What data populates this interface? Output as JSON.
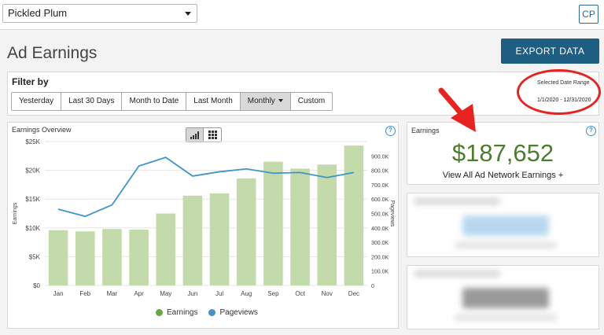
{
  "header": {
    "site_name": "Pickled Plum",
    "avatar_initials": "CP"
  },
  "page": {
    "title": "Ad Earnings",
    "export_label": "EXPORT DATA"
  },
  "filter": {
    "label": "Filter by",
    "buttons": [
      {
        "label": "Yesterday",
        "active": false
      },
      {
        "label": "Last 30 Days",
        "active": false
      },
      {
        "label": "Month to Date",
        "active": false
      },
      {
        "label": "Last Month",
        "active": false
      },
      {
        "label": "Monthly",
        "active": true
      },
      {
        "label": "Custom",
        "active": false
      }
    ],
    "date_range_label": "Selected Date Range",
    "date_range_value": "1/1/2020 - 12/31/2020"
  },
  "overview": {
    "title": "Earnings Overview",
    "help": "?",
    "view_toggle": [
      "bar-chart-icon",
      "grid-icon"
    ],
    "active_view": "bar-chart-icon"
  },
  "earnings_card": {
    "label": "Earnings",
    "amount": "$187,652",
    "link": "View All Ad Network Earnings +",
    "help": "?"
  },
  "colors": {
    "brand": "#1e5e82",
    "earnings_bar": "#c3dbab",
    "pageviews_line": "#3f95c9",
    "earnings_amount": "#4c7d2e",
    "annotation": "#e8231f"
  },
  "chart_data": {
    "type": "bar",
    "categories": [
      "Jan",
      "Feb",
      "Mar",
      "Apr",
      "May",
      "Jun",
      "Jul",
      "Aug",
      "Sep",
      "Oct",
      "Nov",
      "Dec"
    ],
    "series": [
      {
        "name": "Earnings",
        "type": "bar",
        "axis": "left",
        "values": [
          9600,
          9400,
          9800,
          9700,
          12500,
          15600,
          16000,
          18600,
          21500,
          20300,
          21000,
          24300
        ]
      },
      {
        "name": "Pageviews",
        "type": "line",
        "axis": "right",
        "values": [
          530000,
          480000,
          560000,
          830000,
          890000,
          760000,
          790000,
          810000,
          780000,
          785000,
          750000,
          785000
        ]
      }
    ],
    "xlabel": "",
    "ylabel": "Earnings",
    "y2label": "Pageviews",
    "ylim": [
      0,
      25000
    ],
    "y2lim": [
      0,
      1000000
    ],
    "yticks": [
      "$0",
      "$5K",
      "$10K",
      "$15K",
      "$20K",
      "$25K"
    ],
    "y2ticks": [
      "0",
      "100.0K",
      "200.0K",
      "300.0K",
      "400.0K",
      "500.0K",
      "600.0K",
      "700.0K",
      "800.0K",
      "900.0K"
    ],
    "y2tick_values": [
      0,
      100000,
      200000,
      300000,
      400000,
      500000,
      600000,
      700000,
      800000,
      900000
    ],
    "grid": true,
    "legend_position": "bottom"
  }
}
